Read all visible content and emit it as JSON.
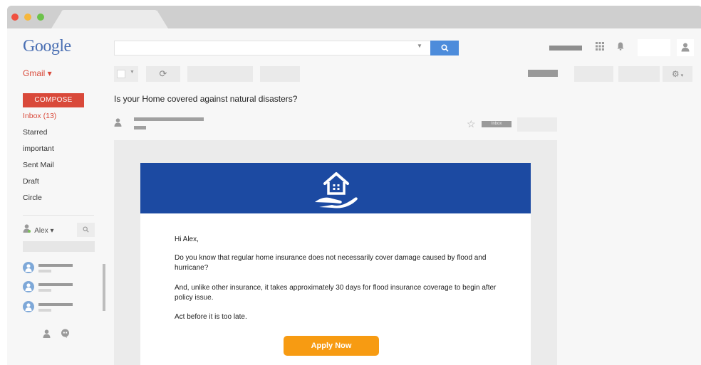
{
  "header": {
    "logo": "Google",
    "search_placeholder": "",
    "search_button_icon": "search-icon"
  },
  "sidebar": {
    "gmail_label": "Gmail ▾",
    "compose_label": "COMPOSE",
    "items": [
      {
        "label": "Inbox (13)",
        "active": true
      },
      {
        "label": "Starred",
        "active": false
      },
      {
        "label": "important",
        "active": false
      },
      {
        "label": "Sent Mail",
        "active": false
      },
      {
        "label": "Draft",
        "active": false
      },
      {
        "label": "Circle",
        "active": false
      }
    ],
    "chat_user": "Alex ▾"
  },
  "message": {
    "subject": "Is your Home covered against natural disasters?",
    "inbox_label": "Inbox",
    "greeting": "Hi Alex,",
    "paragraphs": [
      "Do you know that regular home insurance does not necessarily cover damage caused by flood and hurricane?",
      "And, unlike other insurance, it takes approximately 30 days for flood insurance coverage to begin after policy issue.",
      "Act before it is too late."
    ],
    "cta_label": "Apply Now"
  },
  "colors": {
    "banner": "#1c4aa2",
    "cta": "#f79b12",
    "gmail_red": "#d9493a",
    "search_blue": "#4d8cdb"
  }
}
